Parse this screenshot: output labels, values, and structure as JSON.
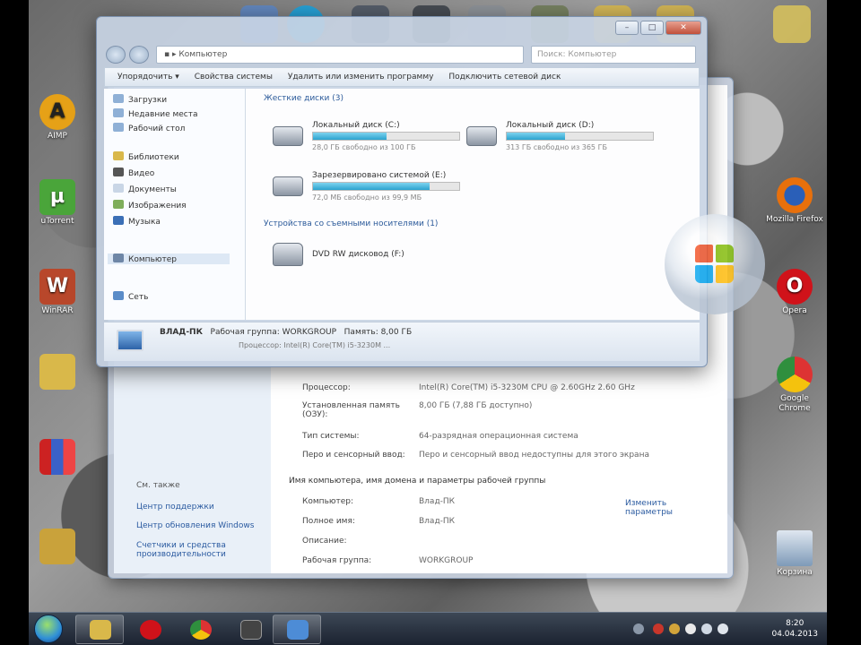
{
  "desktop_icons": [
    {
      "id": "aimp",
      "label": "AIMP",
      "color": "#e6a117",
      "glyph": "A"
    },
    {
      "id": "utorrent",
      "label": "uTorrent",
      "color": "#4aa53a",
      "glyph": "µ"
    },
    {
      "id": "winrar",
      "label": "WinRAR",
      "color": "#b8472b",
      "glyph": "W"
    },
    {
      "id": "folder",
      "label": "",
      "color": "#d9b84a",
      "glyph": ""
    },
    {
      "id": "mixer",
      "label": "",
      "color": "#3a61c8",
      "glyph": ""
    },
    {
      "id": "installer",
      "label": "",
      "color": "#c9a23b",
      "glyph": ""
    },
    {
      "id": "firefox",
      "label": "Mozilla Firefox",
      "color": "#e8700c",
      "glyph": ""
    },
    {
      "id": "opera",
      "label": "Opera",
      "color": "#d0121a",
      "glyph": "O"
    },
    {
      "id": "chrome",
      "label": "Google Chrome",
      "color": "#2f8f3e",
      "glyph": ""
    },
    {
      "id": "recycle-bin",
      "label": "Корзина",
      "color": "#7e9ab8",
      "glyph": ""
    }
  ],
  "explorer": {
    "address": "Компьютер",
    "search_placeholder": "Поиск: Компьютер",
    "toolbar": [
      "Упорядочить ▾",
      "Свойства системы",
      "Удалить или изменить программу",
      "Подключить сетевой диск"
    ],
    "nav": {
      "favorites": [
        "Загрузки",
        "Недавние места",
        "Рабочий стол"
      ],
      "libraries": [
        "Библиотеки",
        "Видео",
        "Документы",
        "Изображения",
        "Музыка"
      ],
      "computer": "Компьютер",
      "network": "Сеть"
    },
    "group_hdd": "Жесткие диски (3)",
    "drives": [
      {
        "name": "Локальный диск (C:)",
        "free": "28,0 ГБ свободно из 100 ГБ",
        "fill": 0.5
      },
      {
        "name": "Локальный диск (D:)",
        "free": "313 ГБ свободно из 365 ГБ",
        "fill": 0.4
      },
      {
        "name": "Зарезервировано системой (E:)",
        "free": "72,0 МБ свободно из 99,9 МБ",
        "fill": 0.8
      }
    ],
    "group_removable": "Устройства со съемными носителями (1)",
    "dvd": "DVD RW дисковод (F:)",
    "details": {
      "name": "ВЛАД-ПК",
      "workgroup": "Рабочая группа: WORKGROUP",
      "memory": "Память: 8,00 ГБ",
      "processor": "Процессор: Intel(R) Core(TM) i5-3230M ..."
    }
  },
  "system_window": {
    "rows": [
      {
        "label": "Процессор:",
        "value": "Intel(R) Core(TM) i5-3230M CPU @ 2.60GHz   2.60 GHz"
      },
      {
        "label": "Установленная память (ОЗУ):",
        "value": "8,00 ГБ (7,88 ГБ доступно)"
      },
      {
        "label": "Тип системы:",
        "value": "64-разрядная операционная система"
      },
      {
        "label": "Перо и сенсорный ввод:",
        "value": "Перо и сенсорный ввод недоступны для этого экрана"
      }
    ],
    "section": "Имя компьютера, имя домена и параметры рабочей группы",
    "rows2": [
      {
        "label": "Компьютер:",
        "value": "Влад-ПК"
      },
      {
        "label": "Полное имя:",
        "value": "Влад-ПК"
      },
      {
        "label": "Описание:",
        "value": ""
      },
      {
        "label": "Рабочая группа:",
        "value": "WORKGROUP"
      }
    ],
    "change_settings": "Изменить параметры",
    "see_also": "См. также",
    "links": [
      "Центр поддержки",
      "Центр обновления Windows",
      "Счетчики и средства производительности"
    ]
  },
  "taskbar": {
    "clock_time": "8:20",
    "clock_date": "04.04.2013"
  }
}
